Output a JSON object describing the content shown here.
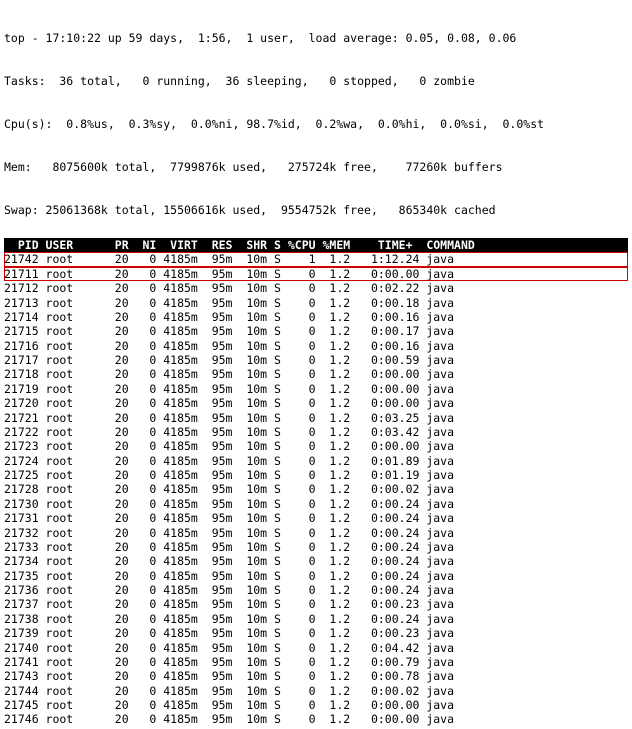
{
  "summary": {
    "line1": "top - 17:10:22 up 59 days,  1:56,  1 user,  load average: 0.05, 0.08, 0.06",
    "line2": "Tasks:  36 total,   0 running,  36 sleeping,   0 stopped,   0 zombie",
    "line3": "Cpu(s):  0.8%us,  0.3%sy,  0.0%ni, 98.7%id,  0.2%wa,  0.0%hi,  0.0%si,  0.0%st",
    "line4": "Mem:   8075600k total,  7799876k used,   275724k free,    77260k buffers",
    "line5": "Swap: 25061368k total, 15506616k used,  9554752k free,   865340k cached"
  },
  "columns": "  PID USER      PR  NI  VIRT  RES  SHR S %CPU %MEM    TIME+  COMMAND            ",
  "rows": [
    {
      "text": "21742 root      20   0 4185m  95m  10m S    1  1.2   1:12.24 java",
      "hl": true
    },
    {
      "text": "21711 root      20   0 4185m  95m  10m S    0  1.2   0:00.00 java",
      "hl": true
    },
    {
      "text": "21712 root      20   0 4185m  95m  10m S    0  1.2   0:02.22 java"
    },
    {
      "text": "21713 root      20   0 4185m  95m  10m S    0  1.2   0:00.18 java"
    },
    {
      "text": "21714 root      20   0 4185m  95m  10m S    0  1.2   0:00.16 java"
    },
    {
      "text": "21715 root      20   0 4185m  95m  10m S    0  1.2   0:00.17 java"
    },
    {
      "text": "21716 root      20   0 4185m  95m  10m S    0  1.2   0:00.16 java"
    },
    {
      "text": "21717 root      20   0 4185m  95m  10m S    0  1.2   0:00.59 java"
    },
    {
      "text": "21718 root      20   0 4185m  95m  10m S    0  1.2   0:00.00 java"
    },
    {
      "text": "21719 root      20   0 4185m  95m  10m S    0  1.2   0:00.00 java"
    },
    {
      "text": "21720 root      20   0 4185m  95m  10m S    0  1.2   0:00.00 java"
    },
    {
      "text": "21721 root      20   0 4185m  95m  10m S    0  1.2   0:03.25 java"
    },
    {
      "text": "21722 root      20   0 4185m  95m  10m S    0  1.2   0:03.42 java"
    },
    {
      "text": "21723 root      20   0 4185m  95m  10m S    0  1.2   0:00.00 java"
    },
    {
      "text": "21724 root      20   0 4185m  95m  10m S    0  1.2   0:01.89 java"
    },
    {
      "text": "21725 root      20   0 4185m  95m  10m S    0  1.2   0:01.19 java"
    },
    {
      "text": "21728 root      20   0 4185m  95m  10m S    0  1.2   0:00.02 java"
    },
    {
      "text": "21730 root      20   0 4185m  95m  10m S    0  1.2   0:00.24 java"
    },
    {
      "text": "21731 root      20   0 4185m  95m  10m S    0  1.2   0:00.24 java"
    },
    {
      "text": "21732 root      20   0 4185m  95m  10m S    0  1.2   0:00.24 java"
    },
    {
      "text": "21733 root      20   0 4185m  95m  10m S    0  1.2   0:00.24 java"
    },
    {
      "text": "21734 root      20   0 4185m  95m  10m S    0  1.2   0:00.24 java"
    },
    {
      "text": "21735 root      20   0 4185m  95m  10m S    0  1.2   0:00.24 java"
    },
    {
      "text": "21736 root      20   0 4185m  95m  10m S    0  1.2   0:00.24 java"
    },
    {
      "text": "21737 root      20   0 4185m  95m  10m S    0  1.2   0:00.23 java"
    },
    {
      "text": "21738 root      20   0 4185m  95m  10m S    0  1.2   0:00.24 java"
    },
    {
      "text": "21739 root      20   0 4185m  95m  10m S    0  1.2   0:00.23 java"
    },
    {
      "text": "21740 root      20   0 4185m  95m  10m S    0  1.2   0:04.42 java"
    },
    {
      "text": "21741 root      20   0 4185m  95m  10m S    0  1.2   0:00.79 java"
    },
    {
      "text": "21743 root      20   0 4185m  95m  10m S    0  1.2   0:00.78 java"
    },
    {
      "text": "21744 root      20   0 4185m  95m  10m S    0  1.2   0:00.02 java"
    },
    {
      "text": "21745 root      20   0 4185m  95m  10m S    0  1.2   0:00.00 java"
    },
    {
      "text": "21746 root      20   0 4185m  95m  10m S    0  1.2   0:00.00 java"
    }
  ]
}
